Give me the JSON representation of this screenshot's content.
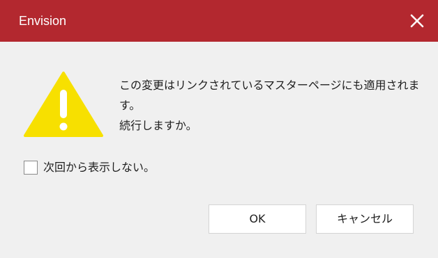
{
  "window": {
    "title": "Envision",
    "titlebar_color": "#b3282f",
    "close_icon": "close-icon"
  },
  "warning_icon": {
    "name": "warning-triangle-icon",
    "color": "#f7e000"
  },
  "message": {
    "line1": "この変更はリンクされているマスターページにも適用されま",
    "line2": "す。",
    "line3": "続行しますか。"
  },
  "dont_show_again": {
    "label": "次回から表示しない。",
    "checked": false
  },
  "buttons": {
    "ok_label": "OK",
    "cancel_label": "キャンセル"
  }
}
